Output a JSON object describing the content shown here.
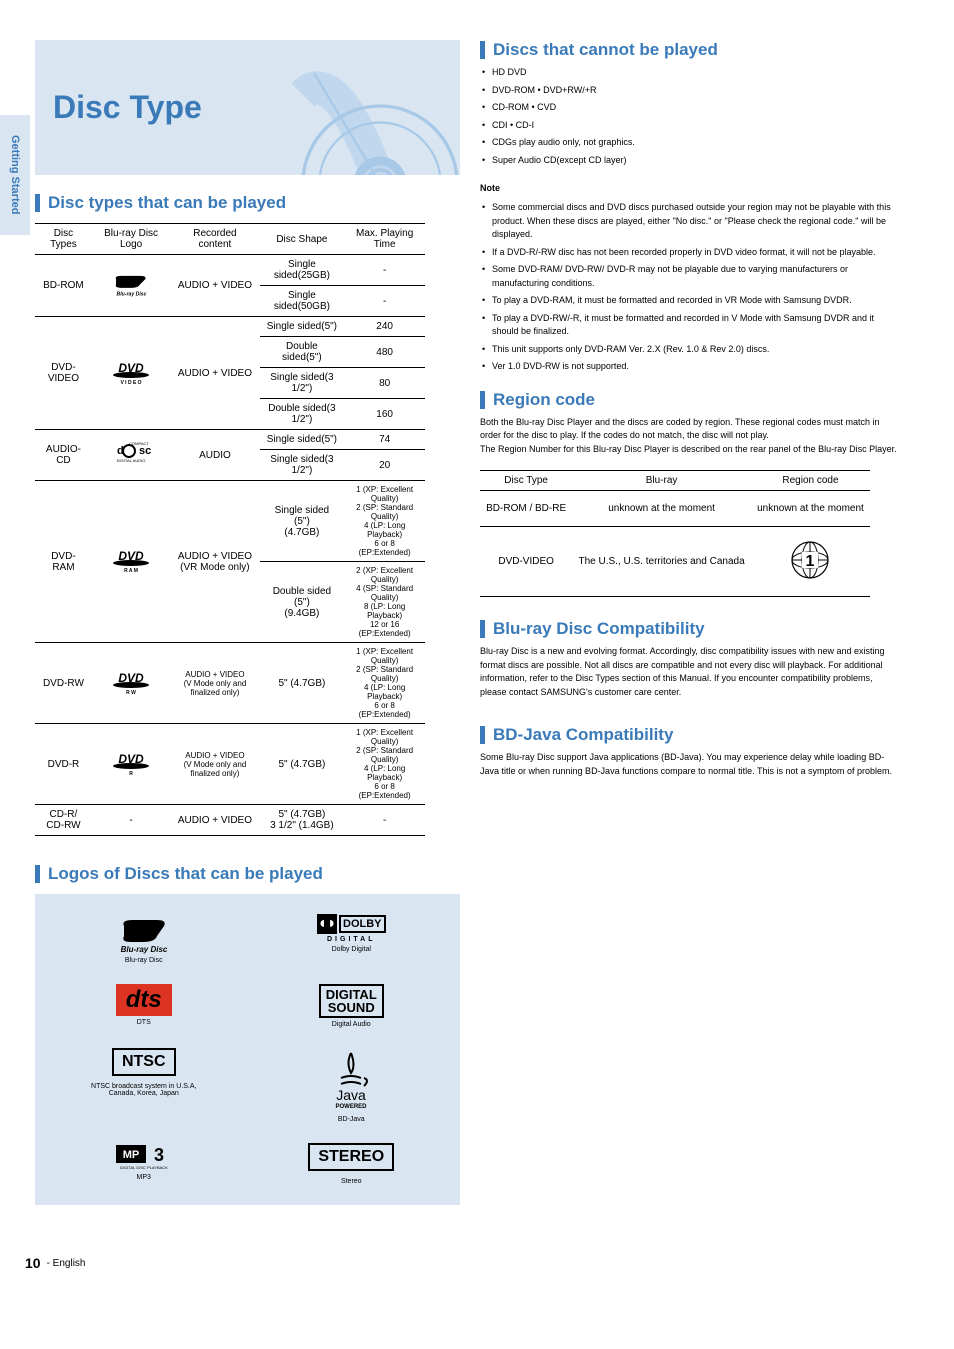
{
  "side_tab": "Getting Started",
  "title": "Disc Type",
  "sections": {
    "playable": "Disc types that can be played",
    "logos": "Logos of Discs that can be played",
    "cannot": "Discs that cannot be played",
    "region": "Region code",
    "compat": "Blu-ray Disc Compatibility",
    "bdj": "BD-Java Compatibility"
  },
  "table1": {
    "headers": [
      "Disc Types",
      "Blu-ray Disc Logo",
      "Recorded content",
      "Disc Shape",
      "Max. Playing Time"
    ],
    "rows": [
      {
        "type": "BD-ROM",
        "content": "AUDIO  +  VIDEO",
        "shapes": [
          "Single sided(25GB)",
          "Single sided(50GB)"
        ],
        "times": [
          "-",
          "-"
        ]
      },
      {
        "type": "DVD-VIDEO",
        "content": "AUDIO  +  VIDEO",
        "shapes": [
          "Single sided(5\")",
          "Double sided(5\")",
          "Single sided(3 1/2\")",
          "Double sided(3 1/2\")"
        ],
        "times": [
          "240",
          "480",
          "80",
          "160"
        ]
      },
      {
        "type": "AUDIO-CD",
        "content": "AUDIO",
        "shapes": [
          "Single sided(5\")",
          "Single sided(3 1/2\")"
        ],
        "times": [
          "74",
          "20"
        ]
      },
      {
        "type": "DVD-RAM",
        "content": "AUDIO  +  VIDEO\n(VR Mode only)",
        "shapes": [
          "Single sided (5\")\n(4.7GB)",
          "Double sided (5\")\n(9.4GB)"
        ],
        "times": [
          "1 (XP: Excellent Quality)\n2 (SP: Standard Quality)\n4 (LP: Long Playback)\n6 or 8 (EP:Extended)",
          "2 (XP: Excellent Quality)\n4 (SP: Standard Quality)\n8 (LP: Long Playback)\n12 or 16 (EP:Extended)"
        ]
      },
      {
        "type": "DVD-RW",
        "content": "AUDIO  +  VIDEO\n(V Mode only and finalized only)",
        "shapes": [
          "5\" (4.7GB)"
        ],
        "times": [
          "1 (XP: Excellent Quality)\n2 (SP: Standard Quality)\n4 (LP: Long Playback)\n6 or 8 (EP:Extended)"
        ]
      },
      {
        "type": "DVD-R",
        "content": "AUDIO  +  VIDEO\n(V Mode only and finalized only)",
        "shapes": [
          "5\" (4.7GB)"
        ],
        "times": [
          "1 (XP: Excellent Quality)\n2 (SP: Standard Quality)\n4 (LP: Long Playback)\n6 or 8 (EP:Extended)"
        ]
      },
      {
        "type": "CD-R/\nCD-RW",
        "content": "AUDIO  +  VIDEO",
        "shapes": [
          "5\" (4.7GB)\n3 1/2\" (1.4GB)"
        ],
        "times": [
          "-"
        ]
      }
    ]
  },
  "logos_grid": [
    {
      "name": "Blu-ray Disc",
      "caption": "Blu-ray Disc"
    },
    {
      "name": "DOLBY DIGITAL",
      "caption": "Dolby Digital"
    },
    {
      "name": "dts",
      "caption": "DTS"
    },
    {
      "name": "DIGITAL SOUND",
      "caption": "Digital Audio"
    },
    {
      "name": "NTSC",
      "caption": "NTSC broadcast system in U.S.A, Canada, Korea, Japan"
    },
    {
      "name": "Java",
      "caption": "BD-Java"
    },
    {
      "name": "MP3",
      "caption": "MP3"
    },
    {
      "name": "STEREO",
      "caption": "Stereo"
    }
  ],
  "cannot_list": [
    "HD DVD",
    "DVD-ROM     • DVD+RW/+R",
    "CD-ROM      • CVD",
    "CDI           • CD-I",
    "CDGs play audio only, not graphics.",
    "Super Audio CD(except CD layer)"
  ],
  "cannot_notes": [
    "Some commercial discs and DVD discs purchased outside your region may not be playable with this product. When these discs are played, either \"No disc.\" or \"Please check the regional code.\" will be displayed.",
    "If a DVD-R/-RW disc has not been recorded properly in DVD video format, it will not be playable.",
    "Some DVD-RAM/ DVD-RW/ DVD-R may not be playable due to varying manufacturers or manufacturing conditions.",
    "To play a DVD-RAM, it must be formatted and recorded in VR Mode with Samsung DVDR.",
    "To play a DVD-RW/-R, it must be formatted and recorded in V Mode with Samsung DVDR and it should be finalized.",
    "This unit supports only DVD-RAM Ver. 2.X (Rev. 1.0 & Rev 2.0) discs.",
    "Ver 1.0 DVD-RW is not supported."
  ],
  "region_text": "Both the Blu-ray Disc Player and the discs are coded by region. These regional codes must match in order for the disc to play. If the codes do not match, the disc will not play.\nThe Region Number for this Blu-ray Disc Player is described on the rear panel of the Blu-ray Disc Player.",
  "region_table": {
    "headers": [
      "Disc Type",
      "Blu-ray",
      "Region code"
    ],
    "rows": [
      {
        "type": "BD-ROM / BD-RE",
        "region": "unknown at the moment",
        "code": "unknown at the moment"
      },
      {
        "type": "DVD-VIDEO",
        "region": "The U.S., U.S. territories and Canada",
        "code": "1"
      }
    ]
  },
  "compat_text": "Blu-ray Disc is a new and evolving format. Accordingly, disc compatibility issues with new and existing format discs are possible. Not all discs are compatible and not every disc will playback. For additional information, refer to the Disc Types section of this Manual. If you encounter compatibility problems, please contact SAMSUNG's customer care center.",
  "bdj_text": "Some Blu-ray Disc support Java applications (BD-Java). You may experience delay while loading BD-Java title or when running BD-Java functions compare to normal title. This is not a symptom of problem.",
  "footer": {
    "page": "10",
    "label": "- English"
  }
}
